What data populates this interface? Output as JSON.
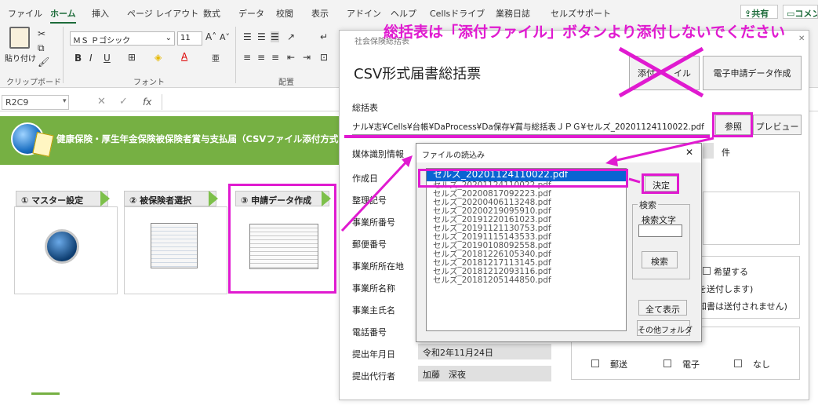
{
  "ribbon": {
    "tabs": [
      "ファイル",
      "ホーム",
      "挿入",
      "ページ レイアウト",
      "数式",
      "データ",
      "校閲",
      "表示",
      "アドイン",
      "ヘルプ",
      "Cellsドライブ",
      "業務日誌",
      "セルズサポート"
    ],
    "share": "共有",
    "comment": "コメン",
    "clipboard_label": "クリップボード",
    "paste_label": "貼り付け",
    "font_label": "フォント",
    "align_label": "配置",
    "font_name": "ＭＳ Ｐゴシック",
    "font_size": "11",
    "bold": "B",
    "italic": "I",
    "underline": "U",
    "font_color": "A"
  },
  "formula_bar": {
    "name_box": "R2C9",
    "fx": "fx"
  },
  "sheet": {
    "banner": "健康保険・厚生年金保険被保険者賞与支払届（CSVファイル添付方式",
    "steps": [
      "① マスター設定",
      "② 被保険者選択",
      "③ 申請データ作成"
    ]
  },
  "dialog": {
    "caption": "社会保険総括表",
    "title": "CSV形式届書総括票",
    "btn_attach": "添付ファイル",
    "btn_attach_visible": "添付",
    "btn_attach_tail": "イル",
    "btn_create": "電子申請データ作成",
    "soukatsu_label": "総括表",
    "path": "ナル¥志¥Cells¥台帳¥DaProcess¥Da保存¥賞与総括表ＪＰＧ¥セルズ_20201124110022.pdf",
    "btn_browse": "参照",
    "btn_preview": "プレビュー",
    "labels": [
      "媒体識別情報",
      "作成日",
      "整理記号",
      "事業所番号",
      "郵便番号",
      "事業所所在地",
      "事業所名称",
      "事業主氏名",
      "電話番号",
      "提出年月日",
      "提出代行者"
    ],
    "ken": "件",
    "submit_date": "令和2年11月24日",
    "agent": "加藤　深夜",
    "kibou": "希望する",
    "frag1": "を送付します)",
    "frag2": "知書は送付されません)",
    "opt_mail": "郵送",
    "opt_denshi": "電子",
    "opt_none": "なし"
  },
  "file_dialog": {
    "title": "ファイルの読込み",
    "close": "✕",
    "files": [
      "セルズ_20201124110022.pdf",
      "セルズ_20201124110022.pdf",
      "セルズ_20200817092223.pdf",
      "セルズ_20200406113248.pdf",
      "セルズ_20200219095910.pdf",
      "セルズ_20191220161023.pdf",
      "セルズ_20191121130753.pdf",
      "セルズ_20191115143533.pdf",
      "セルズ_20190108092558.pdf",
      "セルズ_20181226105340.pdf",
      "セルズ_20181217113145.pdf",
      "セルズ_20181212093116.pdf",
      "セルズ_20181205144850.pdf"
    ],
    "btn_decide": "決定",
    "search_group": "検索",
    "search_label": "検索文字",
    "btn_search": "検索",
    "btn_show_all": "全て表示",
    "btn_other": "その他フォルダ"
  },
  "annotation": {
    "note": "総括表は「添付ファイル」ボタンより添付しないでください"
  },
  "colors": {
    "annotation": "#e01ad0",
    "banner": "#76b043",
    "selection": "#0a64d2",
    "excel_green": "#1d6b3a"
  }
}
